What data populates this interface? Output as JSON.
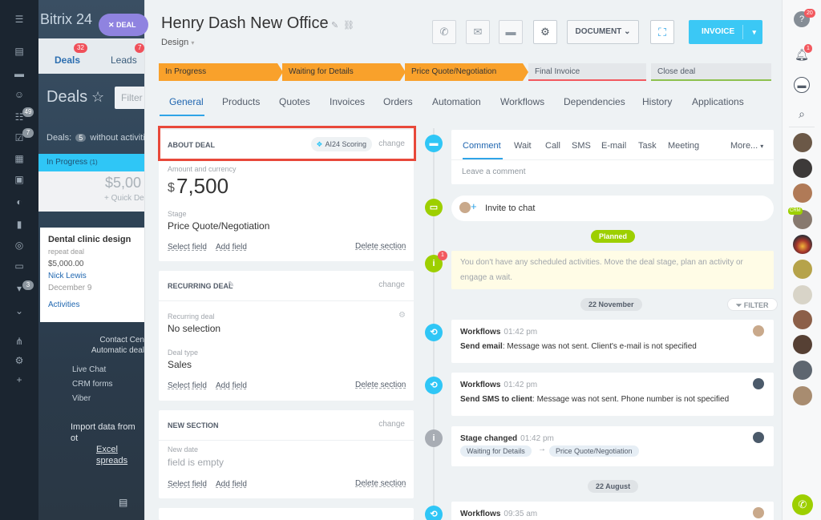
{
  "background": {
    "brand": "Bitrix 24",
    "deal_pill": "DEAL",
    "tabs": [
      {
        "label": "Deals",
        "badge": "32"
      },
      {
        "label": "Leads",
        "badge": "7"
      }
    ],
    "page_heading": "Deals",
    "filter_placeholder": "Filter",
    "deals_info": {
      "prefix": "Deals:",
      "count": "5",
      "suffix": "without activities"
    },
    "stage_column": {
      "name": "In Progress",
      "count": "(1)",
      "sum": "$5,00",
      "quick_deal": "+ Quick De"
    },
    "card": {
      "title": "Dental clinic design",
      "subtitle": "repeat deal",
      "amount": "$5,000.00",
      "contact": "Nick Lewis",
      "date": "December 9",
      "activities": "Activities"
    },
    "contact_center": {
      "line1": "Contact Cen",
      "line2": "Automatic deal",
      "channels": [
        "Live Chat",
        "CRM forms",
        "Viber"
      ]
    },
    "import": {
      "line1": "Import data from ot",
      "line2": "Excel spreads"
    },
    "nav_badges": [
      "49",
      "7",
      "3"
    ]
  },
  "header": {
    "title": "Henry Dash New Office",
    "pipeline": "Design",
    "document_label": "DOCUMENT",
    "invoice_label": "INVOICE"
  },
  "stages": [
    {
      "label": "In Progress",
      "state": "done"
    },
    {
      "label": "Waiting for Details",
      "state": "done"
    },
    {
      "label": "Price Quote/Negotiation",
      "state": "current"
    },
    {
      "label": "Final Invoice",
      "state": "fail"
    },
    {
      "label": "Close deal",
      "state": "success"
    }
  ],
  "tabs": [
    "General",
    "Products",
    "Quotes",
    "Invoices",
    "Orders",
    "Automation",
    "Workflows",
    "Dependencies",
    "History",
    "Applications"
  ],
  "about_deal": {
    "title": "ABOUT DEAL",
    "ai_badge": "AI24 Scoring",
    "change": "change",
    "amount_label": "Amount and currency",
    "currency": "$",
    "amount": "7,500",
    "stage_label": "Stage",
    "stage_value": "Price Quote/Negotiation",
    "select_field": "Select field",
    "add_field": "Add field",
    "delete_section": "Delete section"
  },
  "recurring_deal": {
    "title": "RECURRING DEAL",
    "change": "change",
    "field1_label": "Recurring deal",
    "field1_value": "No selection",
    "field2_label": "Deal type",
    "field2_value": "Sales",
    "select_field": "Select field",
    "add_field": "Add field",
    "delete_section": "Delete section"
  },
  "new_section": {
    "title": "NEW SECTION",
    "change": "change",
    "field_label": "New date",
    "field_value": "field is empty",
    "select_field": "Select field",
    "add_field": "Add field",
    "delete_section": "Delete section"
  },
  "timeline": {
    "comment_tabs": [
      "Comment",
      "Wait",
      "Call",
      "SMS",
      "E-mail",
      "Task",
      "Meeting",
      "More..."
    ],
    "comment_placeholder": "Leave a comment",
    "invite_to_chat": "Invite to chat",
    "planned_label": "Planned",
    "planned_badge": "1",
    "planned_text_1": "You don't have any scheduled activities. Move the deal stage, plan an activity or",
    "planned_text_2": "engage a wait.",
    "date1": "22 November",
    "filter": "FILTER",
    "events": [
      {
        "title": "Workflows",
        "time": "01:42 pm",
        "action": "Send email",
        "text": ": Message was not sent. Client's e-mail is not specified"
      },
      {
        "title": "Workflows",
        "time": "01:42 pm",
        "action": "Send SMS to client",
        "text": ": Message was not sent. Phone number is not specified"
      }
    ],
    "stage_changed": {
      "title": "Stage changed",
      "time": "01:42 pm",
      "from": "Waiting for Details",
      "arrow": "→",
      "to": "Price Quote/Negotiation"
    },
    "date2": "22 August",
    "last_event": {
      "title": "Workflows",
      "time": "09:35 am"
    }
  },
  "rightbar": {
    "help_badge": "20",
    "bell_badge": "1",
    "crm_badge": "CRM"
  },
  "colors": {
    "accent": "#2fa4e7",
    "stage_done": "#f9a12b",
    "invoice": "#3bc8f5",
    "highlight": "#e8483a",
    "timeline_green": "#9dcf00"
  }
}
